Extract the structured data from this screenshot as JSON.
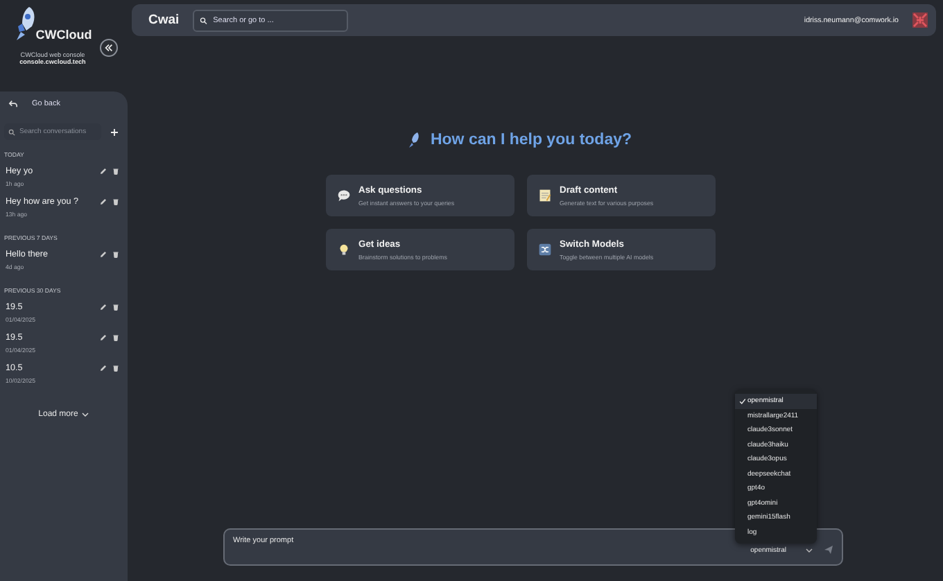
{
  "sidebar": {
    "logo_text": "CWCloud",
    "subtitle": "CWCloud web console",
    "domain": "console.cwcloud.tech",
    "go_back": "Go back",
    "search": {
      "placeholder": "Search conversations"
    },
    "sections": [
      {
        "title": "TODAY",
        "items": [
          {
            "title": "Hey yo",
            "time": "1h ago"
          },
          {
            "title": "Hey how are you ?",
            "time": "13h ago"
          }
        ]
      },
      {
        "title": "PREVIOUS 7 DAYS",
        "items": [
          {
            "title": "Hello there",
            "time": "4d ago"
          }
        ]
      },
      {
        "title": "PREVIOUS 30 DAYS",
        "items": [
          {
            "title": "19.5",
            "time": "01/04/2025"
          },
          {
            "title": "19.5",
            "time": "01/04/2025"
          },
          {
            "title": "10.5",
            "time": "10/02/2025"
          }
        ]
      }
    ],
    "load_more": "Load more"
  },
  "header": {
    "title": "Cwai",
    "search": {
      "placeholder": "Search or go to ..."
    },
    "user": "idriss.neumann@comwork.io"
  },
  "greeting": "How can I help you today?",
  "cards": [
    {
      "kind": "chat",
      "title": "Ask questions",
      "text": "Get instant answers to your queries"
    },
    {
      "kind": "draft",
      "title": "Draft content",
      "text": "Generate text for various purposes"
    },
    {
      "kind": "idea",
      "title": "Get ideas",
      "text": "Brainstorm solutions to problems"
    },
    {
      "kind": "switch",
      "title": "Switch Models",
      "text": "Toggle between multiple AI models"
    }
  ],
  "models": [
    {
      "name": "openmistral",
      "selected": true
    },
    {
      "name": "mistrallarge2411",
      "selected": false
    },
    {
      "name": "claude3sonnet",
      "selected": false
    },
    {
      "name": "claude3haiku",
      "selected": false
    },
    {
      "name": "claude3opus",
      "selected": false
    },
    {
      "name": "deepseekchat",
      "selected": false
    },
    {
      "name": "gpt4o",
      "selected": false
    },
    {
      "name": "gpt4omini",
      "selected": false
    },
    {
      "name": "gemini15flash",
      "selected": false
    },
    {
      "name": "log",
      "selected": false
    }
  ],
  "prompt": {
    "placeholder": "Write your prompt",
    "model": "openmistral"
  }
}
